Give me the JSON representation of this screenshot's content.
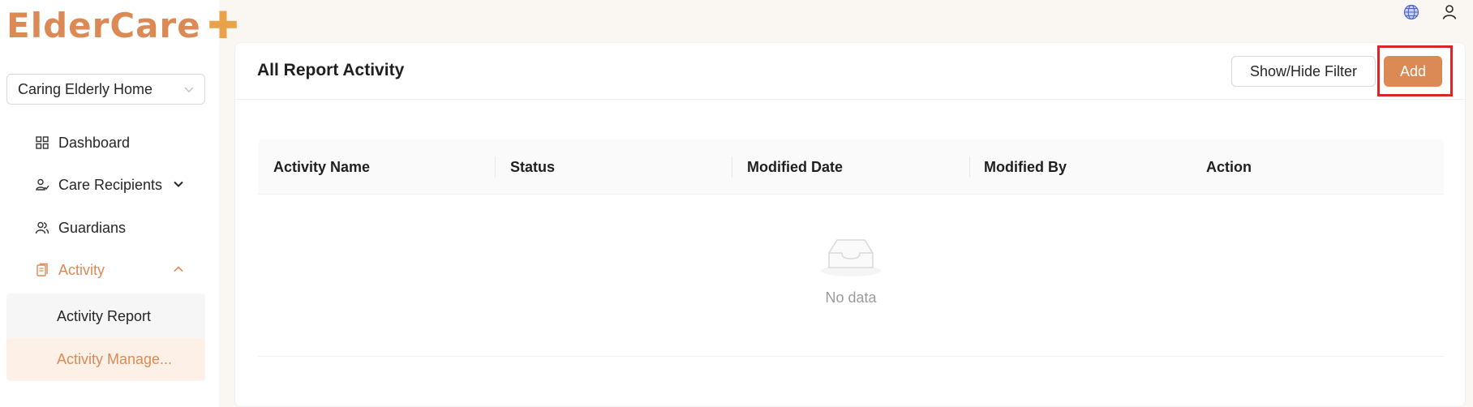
{
  "brand": {
    "logo_text": "ElderCare",
    "accent_color": "#dc8a55"
  },
  "header": {
    "icons": [
      "globe-icon",
      "user-icon"
    ]
  },
  "sidebar": {
    "org_select": {
      "value": "Caring Elderly Home"
    },
    "items": [
      {
        "label": "Dashboard",
        "icon": "grid-icon"
      },
      {
        "label": "Care Recipients",
        "icon": "person-icon",
        "expanded": false
      },
      {
        "label": "Guardians",
        "icon": "people-icon"
      },
      {
        "label": "Activity",
        "icon": "document-icon",
        "expanded": true,
        "active": true
      }
    ],
    "sub_items": [
      {
        "label": "Activity Report",
        "selected": false
      },
      {
        "label": "Activity Manage...",
        "selected": true
      }
    ]
  },
  "main": {
    "title": "All Report Activity",
    "filter_button": "Show/Hide Filter",
    "add_button": "Add",
    "table": {
      "columns": [
        "Activity Name",
        "Status",
        "Modified Date",
        "Modified By",
        "Action"
      ],
      "rows": [],
      "empty_text": "No data"
    }
  }
}
